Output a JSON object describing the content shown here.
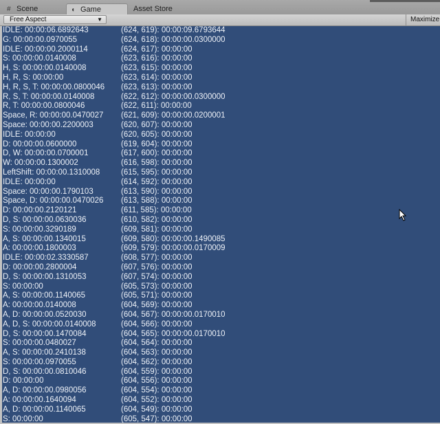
{
  "tabs": [
    {
      "label": "Scene",
      "icon": "grid-icon",
      "active": false
    },
    {
      "label": "Game",
      "icon": "pacman-icon",
      "active": true
    },
    {
      "label": "Asset Store",
      "icon": "",
      "active": false
    }
  ],
  "toolbar": {
    "aspect_label": "Free Aspect",
    "maximize_label": "Maximize"
  },
  "colors": {
    "game_view_background": "#314d79",
    "log_text": "#eef2f8"
  },
  "log": [
    [
      "IDLE: 00:00:06.6892643",
      "(624, 619): 00:00:09.6793644"
    ],
    [
      "G: 00:00:00.0970055",
      "(624, 618): 00:00:00.0300000"
    ],
    [
      "IDLE: 00:00:00.2000114",
      "(624, 617): 00:00:00"
    ],
    [
      "S: 00:00:00.0140008",
      "(623, 616): 00:00:00"
    ],
    [
      "H, S: 00:00:00.0140008",
      "(623, 615): 00:00:00"
    ],
    [
      "H, R, S: 00:00:00",
      "(623, 614): 00:00:00"
    ],
    [
      "H, R, S, T: 00:00:00.0800046",
      "(623, 613): 00:00:00"
    ],
    [
      "R, S, T: 00:00:00.0140008",
      "(622, 612): 00:00:00.0300000"
    ],
    [
      "R, T: 00:00:00.0800046",
      "(622, 611): 00:00:00"
    ],
    [
      "Space, R: 00:00:00.0470027",
      "(621, 609): 00:00:00.0200001"
    ],
    [
      "Space: 00:00:00.2200003",
      "(620, 607): 00:00:00"
    ],
    [
      "IDLE: 00:00:00",
      "(620, 605): 00:00:00"
    ],
    [
      "D: 00:00:00.0600000",
      "(619, 604): 00:00:00"
    ],
    [
      "D, W: 00:00:00.0700001",
      "(617, 600): 00:00:00"
    ],
    [
      "W: 00:00:00.1300002",
      "(616, 598): 00:00:00"
    ],
    [
      "LeftShift: 00:00:00.1310008",
      "(615, 595): 00:00:00"
    ],
    [
      "IDLE: 00:00:00",
      "(614, 592): 00:00:00"
    ],
    [
      "Space: 00:00:00.1790103",
      "(613, 590): 00:00:00"
    ],
    [
      "Space, D: 00:00:00.0470026",
      "(613, 588): 00:00:00"
    ],
    [
      "D: 00:00:00.2120121",
      "(611, 585): 00:00:00"
    ],
    [
      "D, S: 00:00:00.0630036",
      "(610, 582): 00:00:00"
    ],
    [
      "S: 00:00:00.3290189",
      "(609, 581): 00:00:00"
    ],
    [
      "A, S: 00:00:00.1340015",
      "(609, 580): 00:00:00.1490085"
    ],
    [
      "A: 00:00:00.1800003",
      "(609, 579): 00:00:00.0170009"
    ],
    [
      "IDLE: 00:00:02.3330587",
      "(608, 577): 00:00:00"
    ],
    [
      "D: 00:00:00.2800004",
      "(607, 576): 00:00:00"
    ],
    [
      "D, S: 00:00:00.1310053",
      "(607, 574): 00:00:00"
    ],
    [
      "S: 00:00:00",
      "(605, 573): 00:00:00"
    ],
    [
      "A, S: 00:00:00.1140065",
      "(605, 571): 00:00:00"
    ],
    [
      "A: 00:00:00.0140008",
      "(604, 569): 00:00:00"
    ],
    [
      "A, D: 00:00:00.0520030",
      "(604, 567): 00:00:00.0170010"
    ],
    [
      "A, D, S: 00:00:00.0140008",
      "(604, 566): 00:00:00"
    ],
    [
      "D, S: 00:00:00.1470084",
      "(604, 565): 00:00:00.0170010"
    ],
    [
      "S: 00:00:00.0480027",
      "(604, 564): 00:00:00"
    ],
    [
      "A, S: 00:00:00.2410138",
      "(604, 563): 00:00:00"
    ],
    [
      "S: 00:00:00.0970055",
      "(604, 562): 00:00:00"
    ],
    [
      "D, S: 00:00:00.0810046",
      "(604, 559): 00:00:00"
    ],
    [
      "D: 00:00:00",
      "(604, 556): 00:00:00"
    ],
    [
      "A, D: 00:00:00.0980056",
      "(604, 554): 00:00:00"
    ],
    [
      "A: 00:00:00.1640094",
      "(604, 552): 00:00:00"
    ],
    [
      "A, D: 00:00:00.1140065",
      "(604, 549): 00:00:00"
    ],
    [
      "S: 00:00:00",
      "(605, 547): 00:00:00"
    ]
  ]
}
